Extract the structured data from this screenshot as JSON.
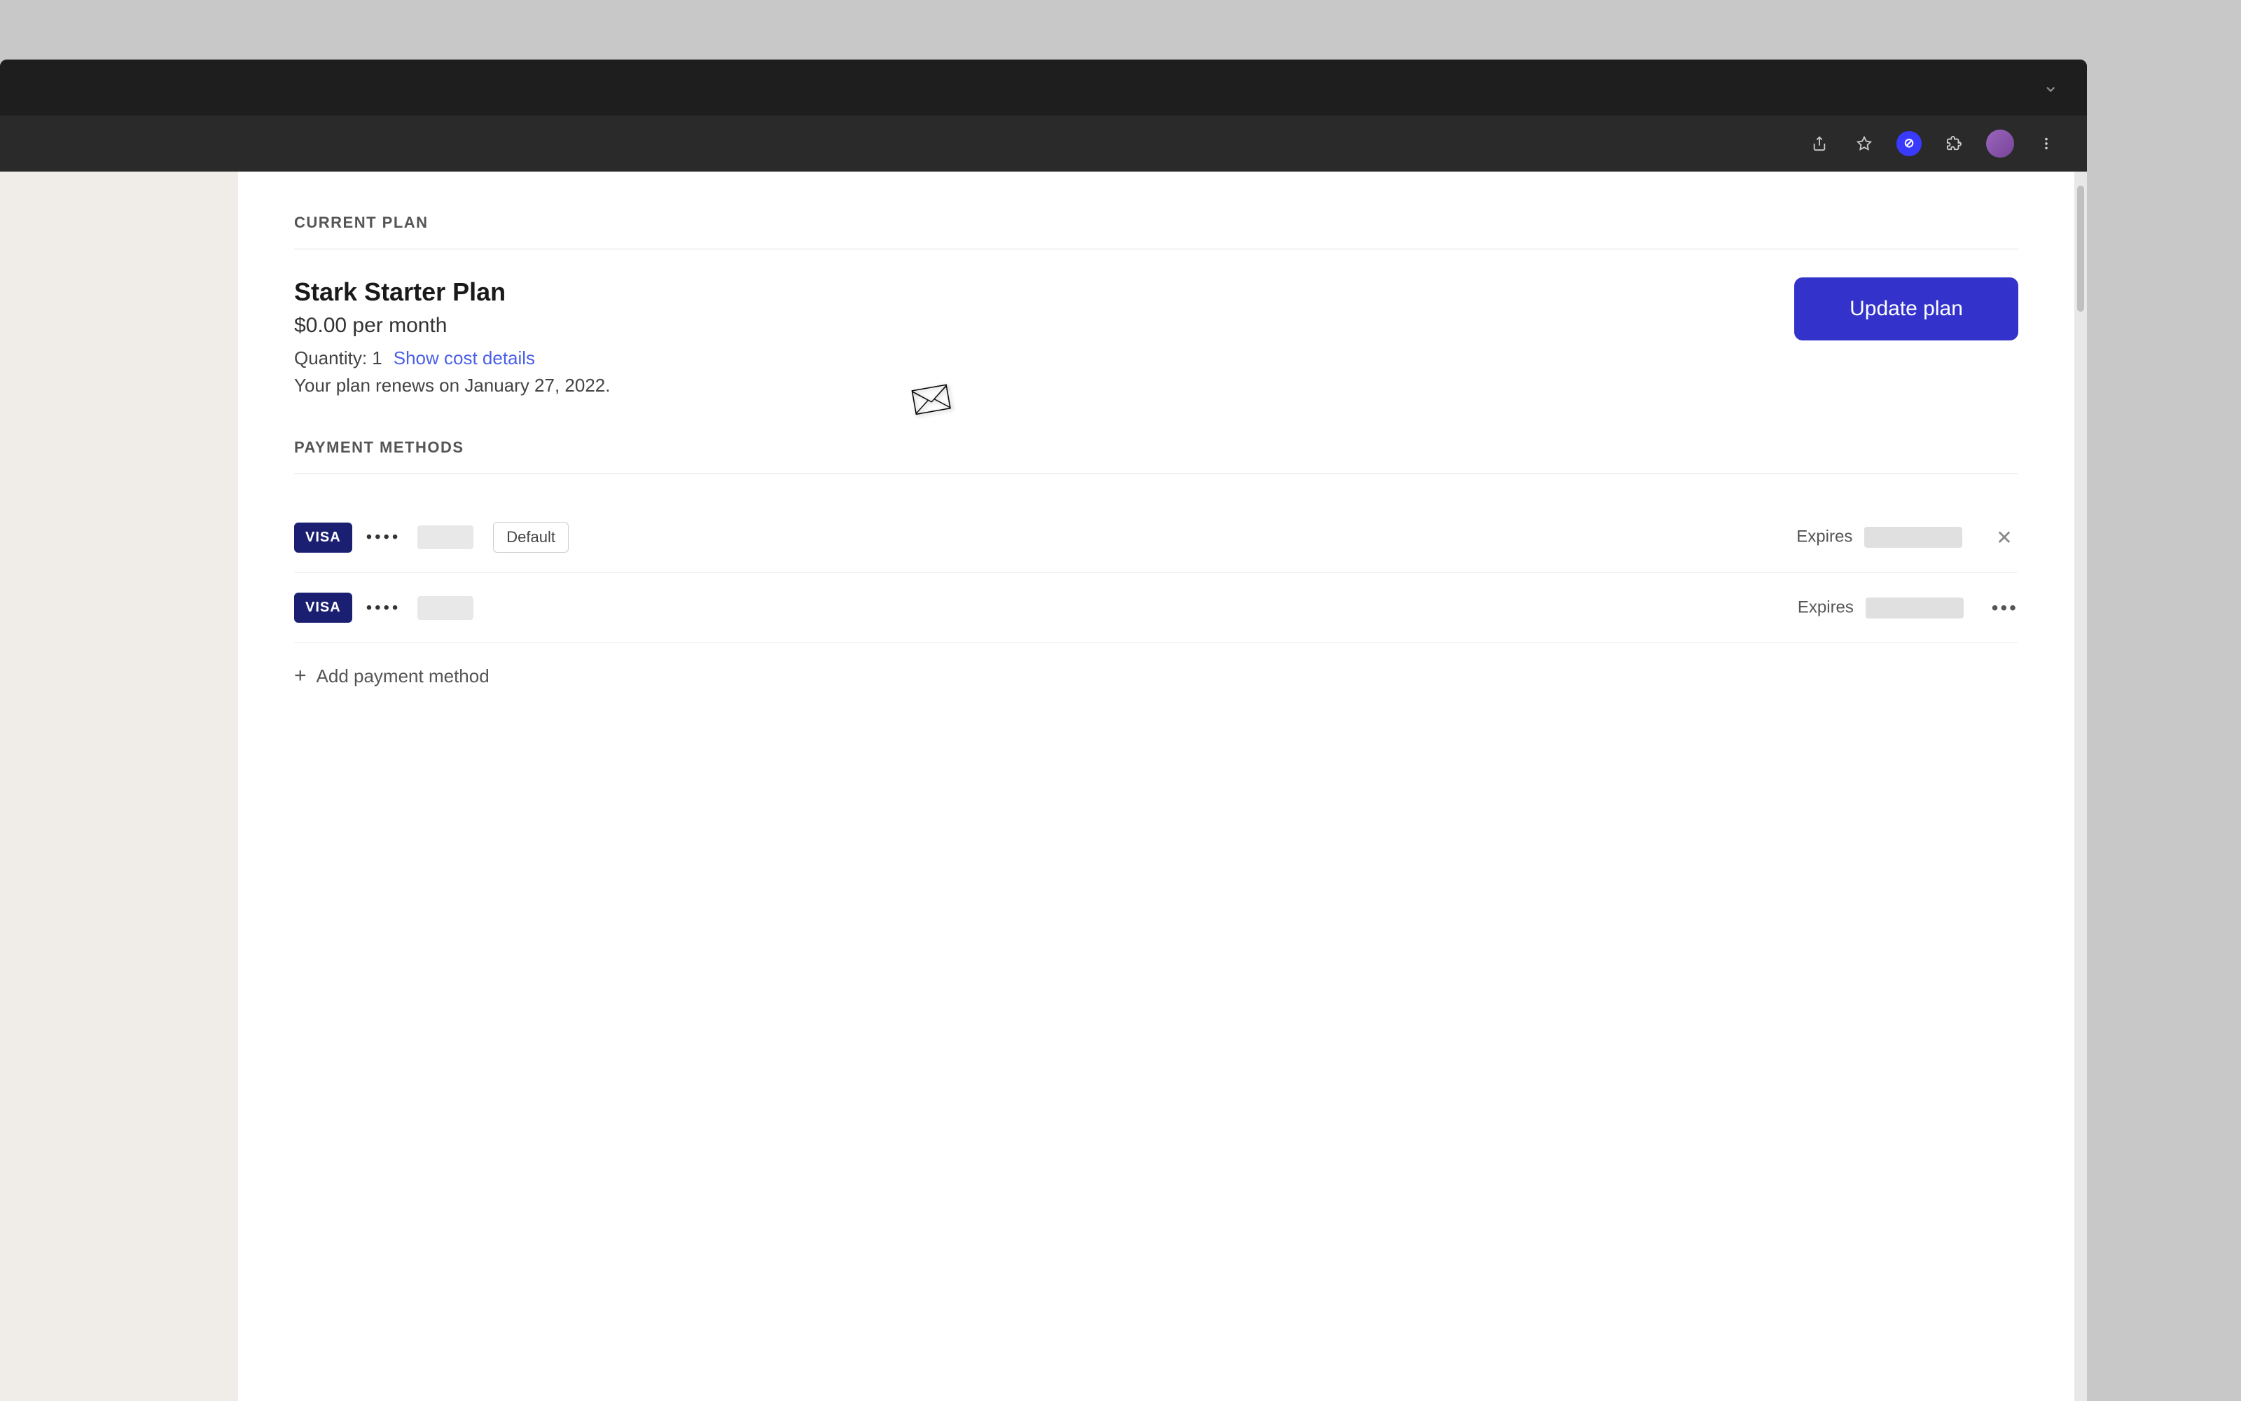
{
  "browser": {
    "chevron": "∨",
    "toolbar_icons": [
      "share",
      "star",
      "adblock",
      "extensions",
      "avatar",
      "more"
    ]
  },
  "current_plan": {
    "section_label": "CURRENT PLAN",
    "plan_name": "Stark Starter Plan",
    "plan_price": "$0.00 per month",
    "quantity_label": "Quantity: 1",
    "show_cost_label": "Show cost details",
    "renewal_text": "Your plan renews on January 27, 2022.",
    "update_button_label": "Update plan"
  },
  "payment_methods": {
    "section_label": "PAYMENT METHODS",
    "cards": [
      {
        "brand": "VISA",
        "dots": "••••",
        "is_default": true,
        "default_label": "Default",
        "expires_label": "Expires",
        "action": "close"
      },
      {
        "brand": "VISA",
        "dots": "••••",
        "is_default": false,
        "expires_label": "Expires",
        "action": "more"
      }
    ],
    "add_payment_label": "Add payment method"
  }
}
